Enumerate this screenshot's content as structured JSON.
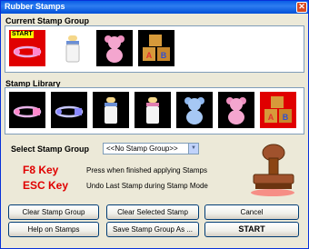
{
  "window": {
    "title": "Rubber Stamps",
    "close_glyph": "✕"
  },
  "current_group": {
    "label": "Current Stamp Group",
    "items": [
      {
        "icon": "safety-pin",
        "tag": "START",
        "selected": true
      },
      {
        "icon": "baby-bottle"
      },
      {
        "icon": "teddy-bear-pink"
      },
      {
        "icon": "abc-blocks"
      }
    ]
  },
  "library": {
    "label": "Stamp Library",
    "items": [
      {
        "icon": "safety-pin-pink"
      },
      {
        "icon": "safety-pin-blue"
      },
      {
        "icon": "baby-bottle"
      },
      {
        "icon": "baby-bottle-pink"
      },
      {
        "icon": "teddy-bear-blue"
      },
      {
        "icon": "teddy-bear-pink"
      },
      {
        "icon": "abc-blocks",
        "selected": true
      }
    ]
  },
  "select_group": {
    "label": "Select Stamp Group",
    "value": "<<No Stamp Group>>"
  },
  "keys": [
    {
      "key": "F8 Key",
      "desc": "Press when finished applying Stamps"
    },
    {
      "key": "ESC Key",
      "desc": "Undo Last Stamp during Stamp Mode"
    }
  ],
  "buttons": {
    "clear_group": "Clear Stamp Group",
    "clear_selected": "Clear Selected Stamp",
    "cancel": "Cancel",
    "help": "Help on Stamps",
    "save_group": "Save Stamp Group As ...",
    "start": "START"
  },
  "colors": {
    "accent_red": "#e00000",
    "title_blue": "#0a5ee6",
    "stamp_brown": "#a0522d"
  }
}
